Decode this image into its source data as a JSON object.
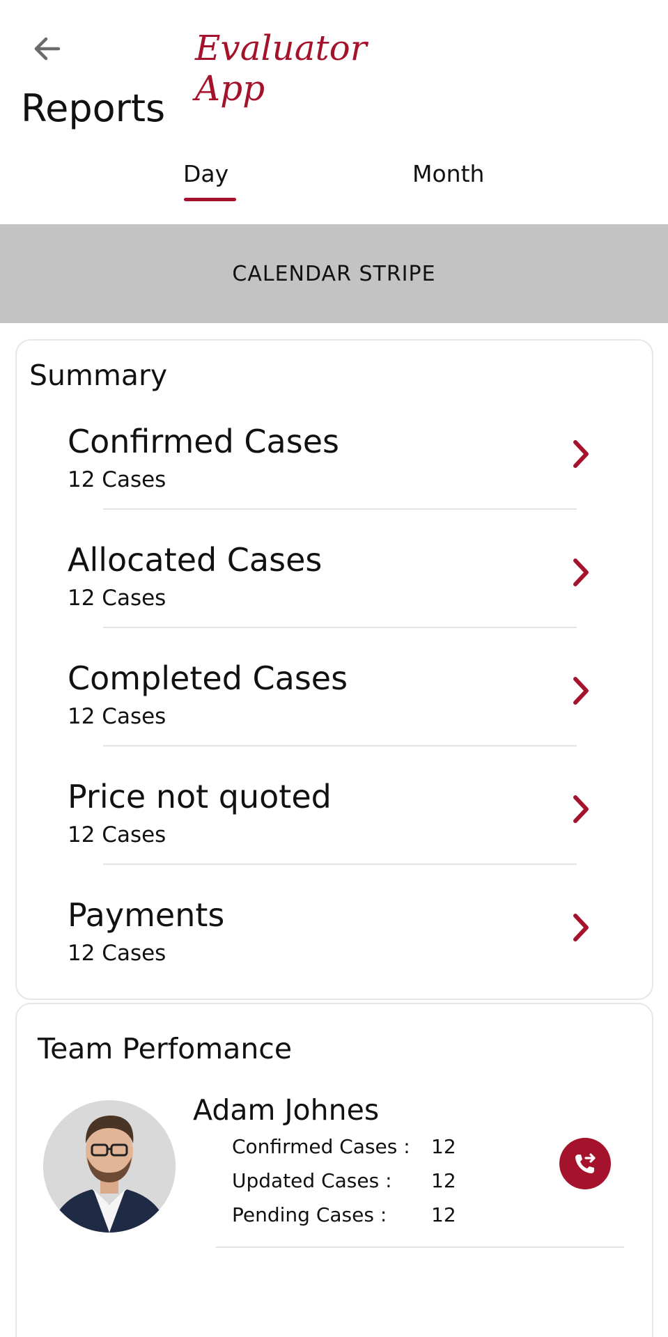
{
  "header": {
    "app_title": "Evaluator App",
    "page_title": "Reports",
    "back_icon": "arrow-left-icon"
  },
  "tabs": {
    "items": [
      {
        "label": "Day",
        "selected": true
      },
      {
        "label": "Month",
        "selected": false
      }
    ]
  },
  "calendar": {
    "label": "CALENDAR STRIPE"
  },
  "summary": {
    "title": "Summary",
    "items": [
      {
        "label": "Confirmed Cases",
        "count": "12 Cases"
      },
      {
        "label": "Allocated Cases",
        "count": "12 Cases"
      },
      {
        "label": "Completed Cases",
        "count": "12 Cases"
      },
      {
        "label": "Price not quoted",
        "count": "12 Cases"
      },
      {
        "label": "Payments",
        "count": "12 Cases"
      }
    ]
  },
  "team": {
    "title": "Team Perfomance",
    "member": {
      "name": "Adam Johnes",
      "stats": [
        {
          "label": "Confirmed Cases :",
          "value": "12"
        },
        {
          "label": "Updated Cases :",
          "value": "12"
        },
        {
          "label": "Pending Cases :",
          "value": "12"
        }
      ]
    }
  },
  "colors": {
    "accent": "#a5122c",
    "calendar_bg": "#c3c3c3",
    "divider": "#e3e3e3"
  }
}
